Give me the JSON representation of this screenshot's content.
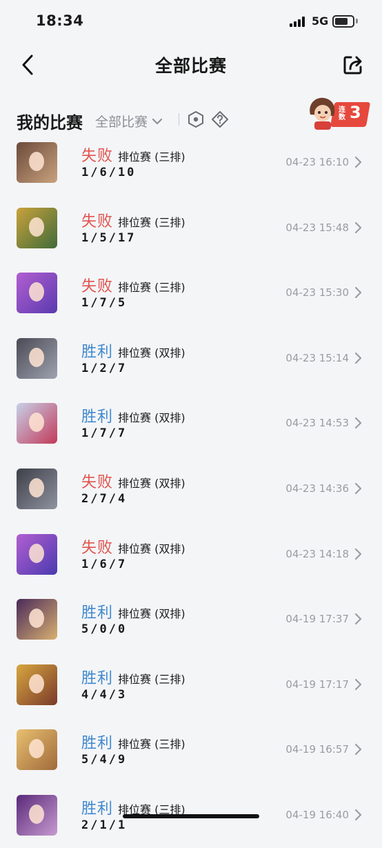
{
  "status_bar": {
    "time": "18:34",
    "network": "5G"
  },
  "nav": {
    "title": "全部比赛"
  },
  "filter": {
    "title": "我的比赛",
    "select_value": "全部比赛"
  },
  "streak": {
    "label": "连数",
    "count": "3"
  },
  "matches": [
    {
      "result": "失败",
      "outcome": "lose",
      "mode": "排位赛 (三排)",
      "kda": "1/6/10",
      "time": "04-23 16:10",
      "avatar_colors": [
        "#6b4a3a",
        "#c9a27e"
      ]
    },
    {
      "result": "失败",
      "outcome": "lose",
      "mode": "排位赛 (三排)",
      "kda": "1/5/17",
      "time": "04-23 15:48",
      "avatar_colors": [
        "#c9a23b",
        "#3f6b3a"
      ]
    },
    {
      "result": "失败",
      "outcome": "lose",
      "mode": "排位赛 (三排)",
      "kda": "1/7/5",
      "time": "04-23 15:30",
      "avatar_colors": [
        "#b25fd0",
        "#5a3ab0"
      ]
    },
    {
      "result": "胜利",
      "outcome": "win",
      "mode": "排位赛 (双排)",
      "kda": "1/2/7",
      "time": "04-23 15:14",
      "avatar_colors": [
        "#4a4a55",
        "#9ea3b0"
      ]
    },
    {
      "result": "胜利",
      "outcome": "win",
      "mode": "排位赛 (双排)",
      "kda": "1/7/7",
      "time": "04-23 14:53",
      "avatar_colors": [
        "#c7d0e8",
        "#c23a5a"
      ]
    },
    {
      "result": "失败",
      "outcome": "lose",
      "mode": "排位赛 (双排)",
      "kda": "2/7/4",
      "time": "04-23 14:36",
      "avatar_colors": [
        "#3d3f48",
        "#8f93a0"
      ]
    },
    {
      "result": "失败",
      "outcome": "lose",
      "mode": "排位赛 (双排)",
      "kda": "1/6/7",
      "time": "04-23 14:18",
      "avatar_colors": [
        "#b25fd0",
        "#4a3ab0"
      ]
    },
    {
      "result": "胜利",
      "outcome": "win",
      "mode": "排位赛 (双排)",
      "kda": "5/0/0",
      "time": "04-19 17:37",
      "avatar_colors": [
        "#4a2a5a",
        "#d9b070"
      ]
    },
    {
      "result": "胜利",
      "outcome": "win",
      "mode": "排位赛 (三排)",
      "kda": "4/4/3",
      "time": "04-19 17:17",
      "avatar_colors": [
        "#d8a640",
        "#7a3a2a"
      ]
    },
    {
      "result": "胜利",
      "outcome": "win",
      "mode": "排位赛 (三排)",
      "kda": "5/4/9",
      "time": "04-19 16:57",
      "avatar_colors": [
        "#e8c070",
        "#a06a3a"
      ]
    },
    {
      "result": "胜利",
      "outcome": "win",
      "mode": "排位赛 (三排)",
      "kda": "2/1/1",
      "time": "04-19 16:40",
      "avatar_colors": [
        "#5a2a7a",
        "#c79ad0"
      ]
    }
  ],
  "colors": {
    "lose": "#e0554f",
    "win": "#3f88cf",
    "background": "#f4f5f7"
  },
  "icons": {
    "back": "chevron-left-icon",
    "share": "share-icon",
    "dropdown": "chevron-down-icon",
    "hex": "hexagon-icon",
    "help": "help-icon",
    "row": "chevron-right-icon"
  }
}
